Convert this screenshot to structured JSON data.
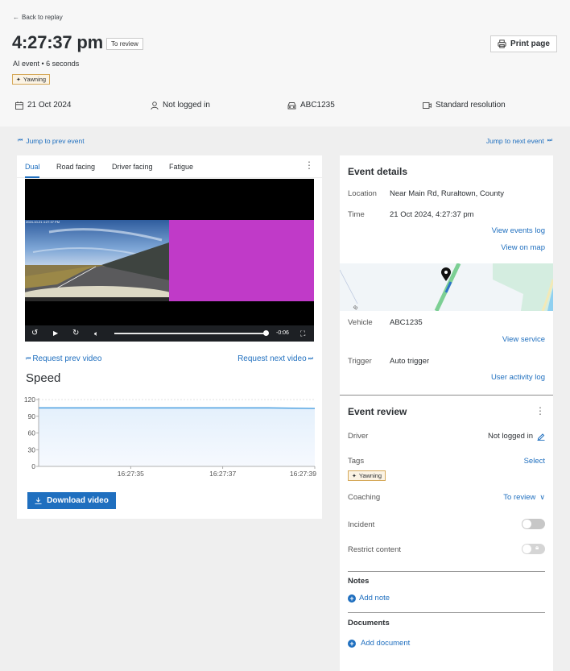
{
  "header": {
    "back_label": "Back to replay",
    "title": "4:27:37 pm",
    "status_chip": "To review",
    "subtitle": "AI event • 6 seconds",
    "tag": "Yawning",
    "print_label": "Print page",
    "meta": {
      "date": "21 Oct 2024",
      "driver": "Not logged in",
      "vehicle": "ABC1235",
      "resolution": "Standard resolution"
    }
  },
  "navigation": {
    "prev_event": "Jump to prev event",
    "next_event": "Jump to next event"
  },
  "video": {
    "tabs": [
      {
        "label": "Dual",
        "active": true
      },
      {
        "label": "Road facing",
        "active": false
      },
      {
        "label": "Driver facing",
        "active": false
      },
      {
        "label": "Fatigue",
        "active": false
      }
    ],
    "overlay_text": "2024-10-21 4:27:37 PM",
    "time_remaining": "-0:06",
    "progress": 0.98,
    "request_prev": "Request prev video",
    "request_next": "Request next video",
    "download_label": "Download video",
    "colors": {
      "driver_placeholder": "#c03ac8"
    }
  },
  "speed": {
    "title": "Speed"
  },
  "chart_data": {
    "type": "area",
    "title": "Speed",
    "xlabel": "",
    "ylabel": "",
    "x": [
      "16:27:33",
      "16:27:34",
      "16:27:35",
      "16:27:36",
      "16:27:37",
      "16:27:38",
      "16:27:39"
    ],
    "series": [
      {
        "name": "Speed",
        "values": [
          105,
          105,
          105,
          105,
          105,
          105,
          104
        ],
        "color": "#4a9fe0"
      }
    ],
    "x_ticks": [
      "16:27:35",
      "16:27:37",
      "16:27:39"
    ],
    "y_ticks": [
      0,
      30,
      60,
      90,
      120
    ],
    "ylim": [
      0,
      120
    ],
    "grid": true,
    "legend": "none"
  },
  "event_details": {
    "title": "Event details",
    "location_label": "Location",
    "location_value": "Near Main Rd, Ruraltown, County",
    "time_label": "Time",
    "time_value": "21 Oct 2024, 4:27:37 pm",
    "view_events_log": "View events log",
    "view_on_map": "View on map",
    "vehicle_label": "Vehicle",
    "vehicle_value": "ABC1235",
    "view_service": "View service",
    "trigger_label": "Trigger",
    "trigger_value": "Auto trigger",
    "user_activity_log": "User activity log",
    "map_road_label": "B"
  },
  "event_review": {
    "title": "Event review",
    "driver_label": "Driver",
    "driver_value": "Not logged in",
    "tags_label": "Tags",
    "tags_action": "Select",
    "tag": "Yawning",
    "coaching_label": "Coaching",
    "coaching_value": "To review",
    "incident_label": "Incident",
    "incident_on": false,
    "restrict_label": "Restrict content",
    "restrict_on": false,
    "notes_title": "Notes",
    "add_note": "Add note",
    "documents_title": "Documents",
    "add_document": "Add document"
  }
}
